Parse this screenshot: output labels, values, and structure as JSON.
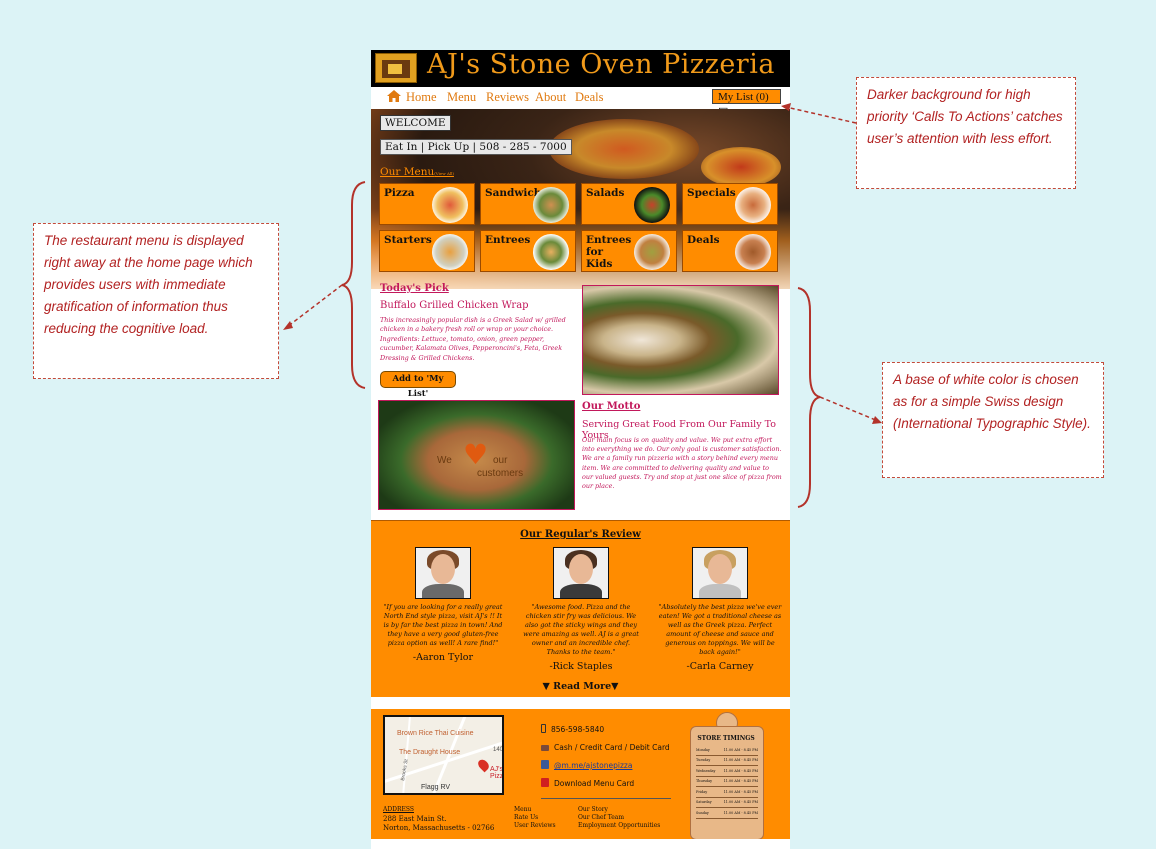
{
  "annotations": {
    "left": "The restaurant menu is displayed right away at the home page which provides users with immediate gratification of information thus reducing the cognitive load.",
    "right_top": "Darker background for high priority ‘Calls To Actions’ catches user’s attention  with less effort.",
    "right_bottom": "A base of white color is chosen as for a simple Swiss design (International Typographic Style)."
  },
  "header": {
    "title": "AJ's Stone Oven Pizzeria"
  },
  "nav": {
    "links": [
      "Home",
      "Menu",
      "Reviews",
      "About",
      "Deals"
    ],
    "my_list": "My List (0)"
  },
  "hero": {
    "welcome": "WELCOME",
    "contact": "Eat In | Pick Up | 508 - 285 - 7000",
    "our_menu": "Our Menu",
    "view_all": "(View All)"
  },
  "menu_tiles": [
    "Pizza",
    "Sandwiches",
    "Salads",
    "Specials",
    "Starters",
    "Entrees",
    "Entrees for Kids",
    "Deals"
  ],
  "todays_pick": {
    "title": "Today's Pick",
    "dish": "Buffalo Grilled Chicken Wrap",
    "description": "This increasingly popular dish is a Greek Salad w/ grilled chicken in a bakery fresh roll or wrap or your choice. Ingredients: Lettuce, tomato, onion, green pepper, cucumber, Kalamata Olives, Pepperoncini's, Feta, Greek Dressing & Grilled Chickens.",
    "button": "Add to 'My List'"
  },
  "veg_image": {
    "w1": "We",
    "w2": "our",
    "w3": "customers"
  },
  "motto": {
    "title": "Our Motto",
    "subtitle": "Serving Great Food From Our Family To Yours",
    "description": "Our main focus is on quality and value. We put extra effort into everything we do. Our only goal is customer satisfaction. We are a family run pizzeria with a story behind every menu item. We are committed to delivering quality and value to our valued guests. Try and stop at just one slice of pizza from our place."
  },
  "reviews": {
    "title": "Our Regular's Review",
    "items": [
      {
        "quote": "\"If you are looking for a really great North End style pizza, visit AJ's !! It is by far the best pizza in town! And they have a very good gluten-free pizza option as well! A rare find!\"",
        "name": "-Aaron Tylor"
      },
      {
        "quote": "\"Awesome food. Pizza and the chicken stir fry was delicious. We also got the sticky wings and they were amazing as well. AJ is a great owner and an incredible chef. Thanks to the team.\"",
        "name": "-Rick Staples"
      },
      {
        "quote": "\"Absolutely the best pizza we've ever eaten! We got a traditional cheese as well as the Greek pizza. Perfect amount of cheese and sauce and generous on toppings. We will be back again!\"",
        "name": "-Carla Carney"
      }
    ],
    "read_more": "Read More"
  },
  "footer": {
    "map_labels": [
      "Brown Rice Thai Cuisine",
      "The Draught House",
      "140",
      "Brooks St",
      "AJ's Pizzeria",
      "Flagg RV"
    ],
    "phone": "856-598-5840",
    "payment": "Cash / Credit Card / Debit Card",
    "facebook": "@m.me/ajstonepizza",
    "download": "Download Menu Card",
    "address_label": "ADDRESS",
    "address_line1": "288 East Main St.",
    "address_line2": "Norton, Massachusetts - 02766",
    "links_col1": [
      "Menu",
      "Rate Us",
      "User Reviews"
    ],
    "links_col2": [
      "Our Story",
      "Our Chef Team",
      "Employment Opportunities"
    ],
    "store_timings": {
      "title": "STORE TIMINGS",
      "rows": [
        {
          "day": "Monday",
          "hours": "11.00 AM - 8.45 PM"
        },
        {
          "day": "Tuesday",
          "hours": "11.00 AM - 8.45 PM"
        },
        {
          "day": "Wednesday",
          "hours": "11.00 AM - 8.45 PM"
        },
        {
          "day": "Thursday",
          "hours": "11.00 AM - 8.45 PM"
        },
        {
          "day": "Friday",
          "hours": "11.00 AM - 8.45 PM"
        },
        {
          "day": "Saturday",
          "hours": "11.00 AM - 8.45 PM"
        },
        {
          "day": "Sunday",
          "hours": "11.00 AM - 8.45 PM"
        }
      ]
    }
  },
  "colors": {
    "accent": "#ff8c00",
    "text_accent": "#c2185b",
    "annotation_border": "#c24a3a",
    "annotation_text": "#b22222",
    "background": "#dcf3f6"
  }
}
